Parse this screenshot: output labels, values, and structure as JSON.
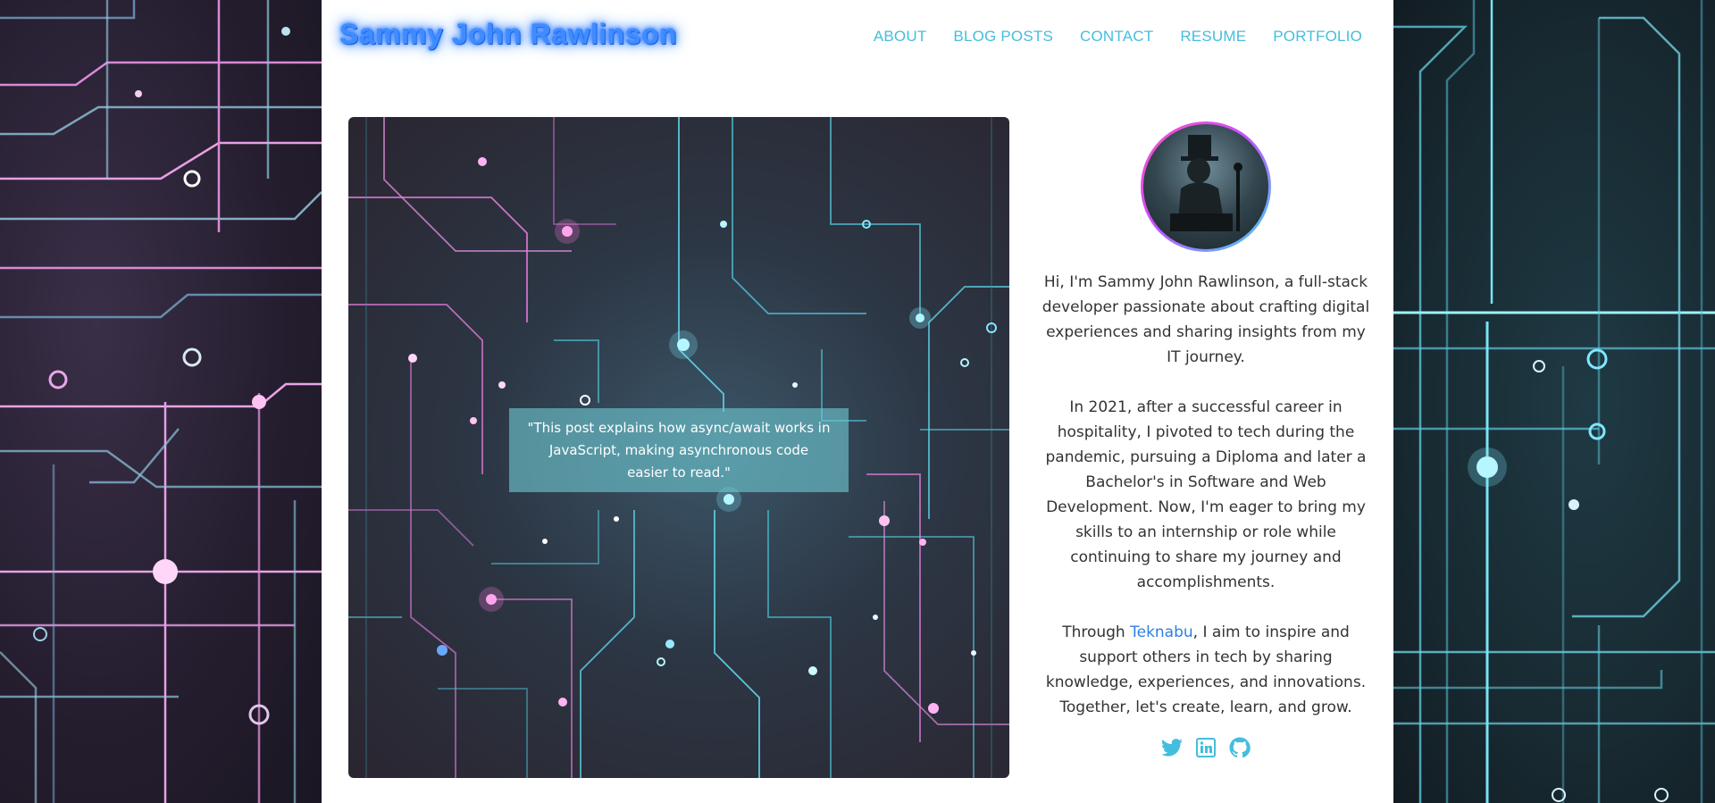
{
  "site": {
    "title": "Sammy John Rawlinson"
  },
  "nav": {
    "items": [
      {
        "label": "ABOUT"
      },
      {
        "label": "BLOG POSTS"
      },
      {
        "label": "CONTACT"
      },
      {
        "label": "RESUME"
      },
      {
        "label": "PORTFOLIO"
      }
    ]
  },
  "hero": {
    "quote": "\"This post explains how async/await works in JavaScript, making asynchronous code easier to read.\""
  },
  "profile": {
    "bio_1": "Hi, I'm Sammy John Rawlinson, a full-stack developer passionate about crafting digital experiences and sharing insights from my IT journey.",
    "bio_2": "In 2021, after a successful career in hospitality, I pivoted to tech during the pandemic, pursuing a Diploma and later a Bachelor's in Software and Web Development. Now, I'm eager to bring my skills to an internship or role while continuing to share my journey and accomplishments.",
    "bio_3_before": "Through ",
    "bio_3_link": "Teknabu",
    "bio_3_after": ", I aim to inspire and support others in tech by sharing knowledge, experiences, and innovations. Together, let's create, learn, and grow."
  },
  "socials": [
    {
      "icon": "twitter-icon"
    },
    {
      "icon": "linkedin-icon"
    },
    {
      "icon": "github-icon"
    }
  ],
  "colors": {
    "nav_link": "#44bedc",
    "title_glow": "#3f8cff",
    "link": "#2d7fe0",
    "social_icon": "#44bedc",
    "circuit_pink": "#e07ad8",
    "circuit_cyan": "#5fd6ea"
  }
}
